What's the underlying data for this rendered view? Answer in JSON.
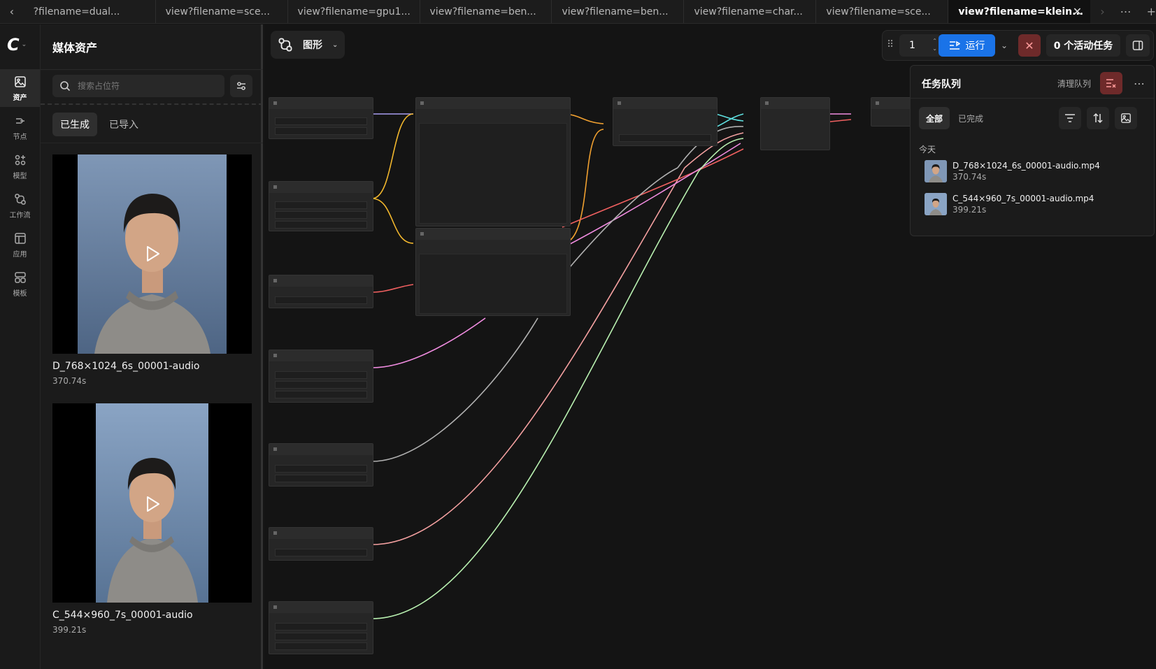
{
  "tabs": [
    {
      "label": "?filename=dual..."
    },
    {
      "label": "view?filename=sce..."
    },
    {
      "label": "view?filename=gpu1..."
    },
    {
      "label": "view?filename=ben..."
    },
    {
      "label": "view?filename=ben..."
    },
    {
      "label": "view?filename=char..."
    },
    {
      "label": "view?filename=sce..."
    },
    {
      "label": "view?filename=klein..."
    }
  ],
  "rail": {
    "items": [
      {
        "label": "资产",
        "icon": "image-icon"
      },
      {
        "label": "节点",
        "icon": "node-icon"
      },
      {
        "label": "模型",
        "icon": "model-icon"
      },
      {
        "label": "工作流",
        "icon": "workflow-icon"
      },
      {
        "label": "应用",
        "icon": "app-icon"
      },
      {
        "label": "模板",
        "icon": "template-icon"
      }
    ]
  },
  "assets": {
    "title": "媒体资产",
    "search_placeholder": "搜索占位符",
    "tabs": [
      {
        "label": "已生成"
      },
      {
        "label": "已导入"
      }
    ],
    "cards": [
      {
        "name": "D_768×1024_6s_00001-audio",
        "time": "370.74s"
      },
      {
        "name": "C_544×960_7s_00001-audio",
        "time": "399.21s"
      }
    ]
  },
  "canvas": {
    "graph_label": "图形"
  },
  "toolbar": {
    "batch_count": "1",
    "run_label": "运行",
    "active_tasks": "0 个活动任务"
  },
  "queue": {
    "title": "任务队列",
    "clear_label": "清理队列",
    "filters": [
      {
        "label": "全部"
      },
      {
        "label": "已完成"
      }
    ],
    "group_label": "今天",
    "items": [
      {
        "name": "D_768×1024_6s_00001-audio.mp4",
        "time": "370.74s"
      },
      {
        "name": "C_544×960_7s_00001-audio.mp4",
        "time": "399.21s"
      }
    ]
  },
  "colors": {
    "accent": "#1a73e8",
    "danger": "#6e2a2a",
    "wire_yellow": "#f2b72d",
    "wire_orange": "#f0a030",
    "wire_lavender": "#a89cf0",
    "wire_red": "#f06060",
    "wire_pink": "#f08ce0",
    "wire_gray": "#b0b0b0",
    "wire_salmon": "#f4a0a0",
    "wire_green": "#b8f0b0",
    "wire_cyan": "#5fe0e0"
  }
}
